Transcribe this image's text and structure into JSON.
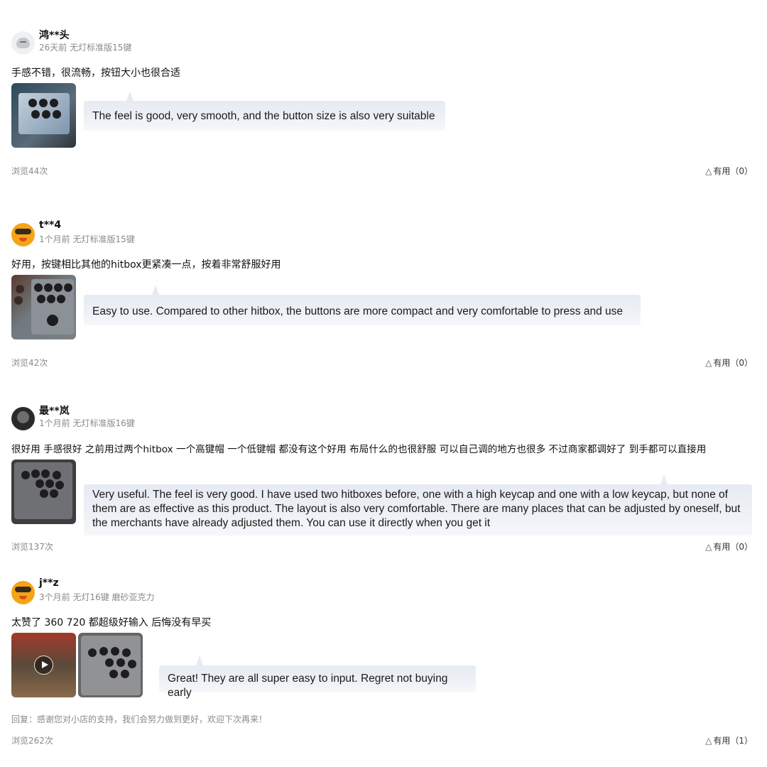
{
  "reviews": [
    {
      "username": "鸿**头",
      "meta": "26天前 无灯标准版15键",
      "text": "手感不错，很流畅，按钮大小也很合适",
      "translation": "The feel is good, very smooth, and the button size is also very suitable",
      "views": "浏览44次",
      "useful": "有用（0）"
    },
    {
      "username": "t**4",
      "meta": "1个月前 无灯标准版15键",
      "text": "好用，按键相比其他的hitbox更紧凑一点，按着非常舒服好用",
      "translation": "Easy to use. Compared to other hitbox, the buttons are more compact and very comfortable to press and use",
      "views": "浏览42次",
      "useful": "有用（0）"
    },
    {
      "username": "最**岚",
      "meta": "1个月前 无灯标准版16键",
      "text": "很好用 手感很好 之前用过两个hitbox 一个高键帽 一个低键帽 都没有这个好用 布局什么的也很舒服 可以自己调的地方也很多 不过商家都调好了 到手都可以直接用",
      "translation": "Very useful. The feel is very good. I have used two hitboxes before, one with a high keycap and one with a low keycap, but none of them are as effective as this product. The layout is also very comfortable. There are many places that can be adjusted by oneself, but the merchants have already adjusted them. You can use it directly when you get it",
      "views": "浏览137次",
      "useful": "有用（0）"
    },
    {
      "username": "j**z",
      "meta": "3个月前 无灯16键 磨砂亚克力",
      "text": "太赞了 360 720 都超级好输入 后悔没有早买",
      "translation": "Great! They are all super easy to input. Regret not buying early",
      "reply": "回复：感谢您对小店的支持，我们会努力做到更好，欢迎下次再来！",
      "views": "浏览262次",
      "useful": "有用（1）"
    }
  ],
  "icons": {
    "useful": "triangle-outline-icon",
    "play": "play-icon"
  }
}
